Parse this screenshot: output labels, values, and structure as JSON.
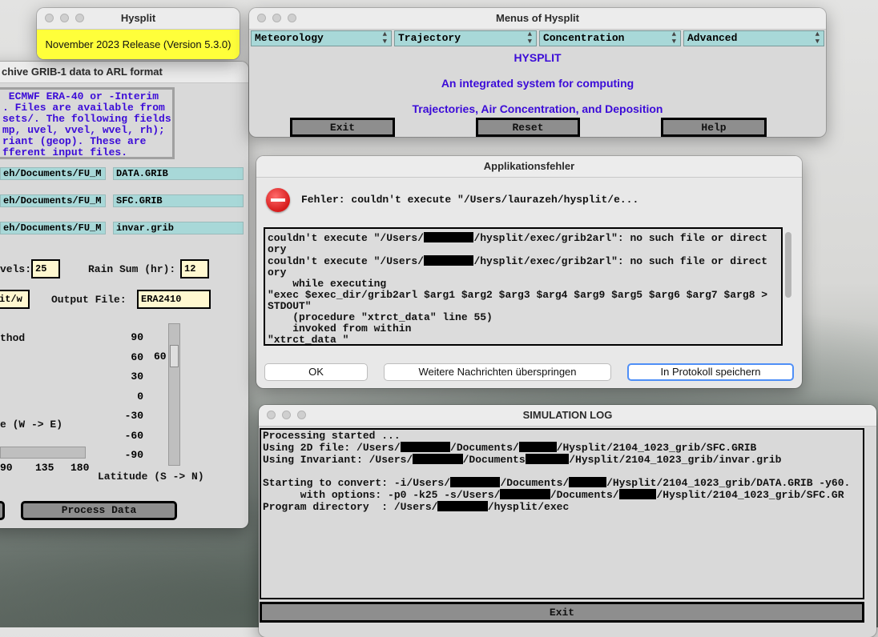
{
  "hysplit_window": {
    "title": "Hysplit",
    "release": "November 2023 Release (Version 5.3.0)"
  },
  "grib_window": {
    "title": "chive GRIB-1 data to ARL format",
    "info_lines": [
      " ECMWF ERA-40 or -Interim",
      ". Files are available from",
      "sets/. The following fields",
      "mp, uvel, vvel, wvel, rh);",
      "riant (geop). These are",
      "fferent input files."
    ],
    "files": [
      {
        "path": "eh/Documents/FU_M",
        "name": "DATA.GRIB"
      },
      {
        "path": "eh/Documents/FU_M",
        "name": "SFC.GRIB"
      },
      {
        "path": "eh/Documents/FU_M",
        "name": "invar.grib"
      }
    ],
    "levels_label": "vels:",
    "levels_value": "25",
    "rain_label": "Rain Sum (hr):",
    "rain_value": "12",
    "output_prefix": "it/w",
    "output_label": "Output File:",
    "output_value": "ERA2410",
    "method_label": "thod",
    "lat_ticks": [
      "90",
      "60",
      "30",
      "0",
      "-30",
      "-60",
      "-90"
    ],
    "lat_value": "60",
    "lon_label": "e (W -> E)",
    "lon_ticks": [
      "90",
      "135",
      "180"
    ],
    "lat_label": "Latitude (S -> N)",
    "process_label": "Process Data"
  },
  "menus_window": {
    "title": "Menus of Hysplit",
    "menus": [
      "Meteorology",
      "Trajectory",
      "Concentration",
      "Advanced"
    ],
    "line1": "HYSPLIT",
    "line2": "An integrated system for computing",
    "line3": "Trajectories, Air Concentration, and Deposition",
    "exit_label": "Exit",
    "reset_label": "Reset",
    "help_label": "Help"
  },
  "error_dialog": {
    "title": "Applikationsfehler",
    "message": "Fehler: couldn't execute \"/Users/laurazeh/hysplit/e...",
    "trace": [
      [
        "couldn't execute \"/Users/",
        "R8",
        "/hysplit/exec/grib2arl\": no such file or direct"
      ],
      [
        "ory"
      ],
      [
        "couldn't execute \"/Users/",
        "R8",
        "/hysplit/exec/grib2arl\": no such file or direct"
      ],
      [
        "ory"
      ],
      [
        "    while executing"
      ],
      [
        "\"exec $exec_dir/grib2arl $arg1 $arg2 $arg3 $arg4 $arg9 $arg5 $arg6 $arg7 $arg8 >"
      ],
      [
        "STDOUT\""
      ],
      [
        "    (procedure \"xtrct_data\" line 55)"
      ],
      [
        "    invoked from within"
      ],
      [
        "\"xtrct_data \""
      ]
    ],
    "ok_label": "OK",
    "skip_label": "Weitere Nachrichten überspringen",
    "save_label": "In Protokoll speichern"
  },
  "sim_log": {
    "title": "SIMULATION LOG",
    "lines": [
      [
        "Processing started ..."
      ],
      [
        "Using 2D file: /Users/",
        "R8",
        "/Documents/",
        "R6",
        "/Hysplit/2104_1023_grib/SFC.GRIB"
      ],
      [
        "Using Invariant: /Users/",
        "R8",
        "/Documents",
        "R7",
        "/Hysplit/2104_1023_grib/invar.grib"
      ],
      [
        ""
      ],
      [
        "Starting to convert: -i/Users/",
        "R8",
        "/Documents/",
        "R6",
        "/Hysplit/2104_1023_grib/DATA.GRIB -y60."
      ],
      [
        "      with options: -p0 -k25 -s/Users/",
        "R8",
        "/Documents/",
        "R6",
        "/Hysplit/2104_1023_grib/SFC.GR"
      ],
      [
        "Program directory  : /Users/",
        "R8",
        "/hysplit/exec"
      ]
    ],
    "exit_label": "Exit"
  }
}
